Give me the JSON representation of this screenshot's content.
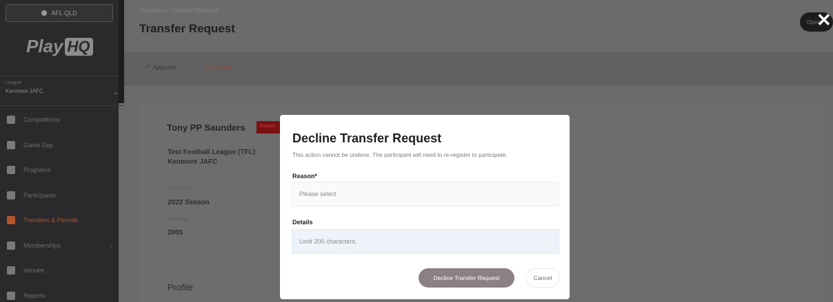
{
  "sidebar": {
    "org_pill": "AFL QLD",
    "logo": {
      "text": "Play",
      "badge": "HQ"
    },
    "league": {
      "label": "League",
      "value": "Kenmore JAFC"
    },
    "items": [
      {
        "label": "Competitions",
        "icon": "trophy-icon"
      },
      {
        "label": "Game Day",
        "icon": "scoreboard-icon"
      },
      {
        "label": "Programs",
        "icon": "programs-icon"
      },
      {
        "label": "Participants",
        "icon": "participants-icon"
      },
      {
        "label": "Transfers & Permits",
        "icon": "transfer-icon"
      },
      {
        "label": "Memberships",
        "icon": "membership-icon"
      },
      {
        "label": "Venues",
        "icon": "venue-icon"
      },
      {
        "label": "Reports",
        "icon": "reports-icon"
      }
    ]
  },
  "header": {
    "breadcrumb": "Transfers / Transfer Request",
    "title": "Transfer Request",
    "approve_label": "Approve",
    "decline_label": "Decline",
    "top_right_label": "Open"
  },
  "participant": {
    "name": "Tony PP Saunders",
    "status": "Suspen",
    "league_line1": "Test Football League (TFL)",
    "league_line2": "Kenmore JAFC",
    "season_label": "Registration",
    "season_value": "2022 Season",
    "year_label": "Year Born",
    "year_value": "2005",
    "profile_label": "Profile"
  },
  "modal": {
    "title": "Decline Transfer Request",
    "subtitle": "This action cannot be undone. The participant will need to re-register to participate.",
    "reason_label": "Reason*",
    "reason_placeholder": "Please select",
    "details_label": "Details",
    "details_placeholder": "Limit 200 characters.",
    "decline_button": "Decline Transfer Request",
    "cancel_button": "Cancel"
  },
  "colors": {
    "accent": "#b3552a",
    "decline_button": "#8b8086",
    "overlay": "#6b6b6b"
  }
}
